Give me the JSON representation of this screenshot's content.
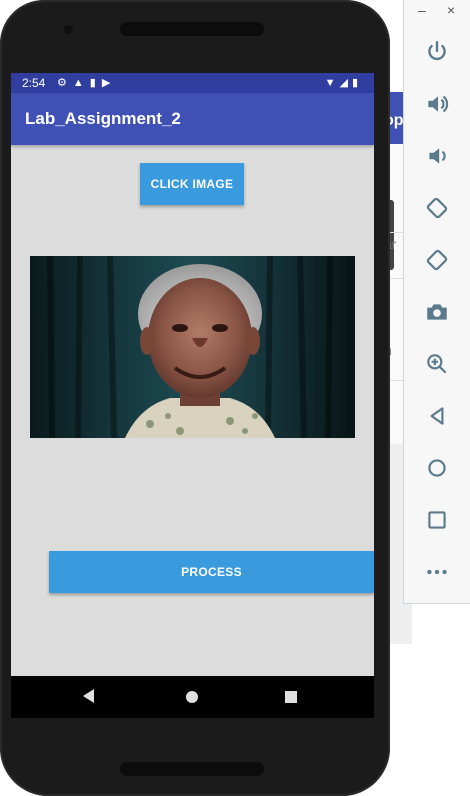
{
  "status": {
    "time": "2:54"
  },
  "app": {
    "title": "Lab_Assignment_2"
  },
  "buttons": {
    "click_image": "CLICK IMAGE",
    "process": "PROCESS"
  },
  "image": {
    "subject": "portrait-photo"
  },
  "toolbar": {
    "minimize": "–",
    "close": "×",
    "items": [
      "power-icon",
      "volume-up-icon",
      "volume-down-icon",
      "rotate-left-icon",
      "rotate-right-icon",
      "camera-icon",
      "zoom-icon",
      "back-icon",
      "home-icon",
      "overview-icon",
      "more-icon"
    ]
  },
  "background": {
    "appbar_fragment": "op",
    "line1": "ar",
    "line2": "n"
  }
}
